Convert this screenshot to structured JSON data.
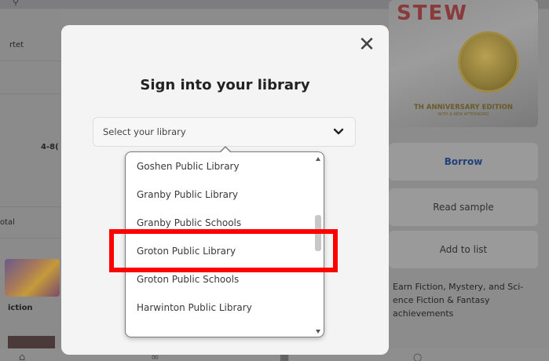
{
  "background": {
    "left_rows": [
      {
        "label": "rtet"
      },
      {
        "label": "4-8("
      },
      {
        "label": "otal"
      },
      {
        "label": "iction"
      }
    ],
    "cover": {
      "title": "STEW",
      "anniversary": "TH ANNIVERSARY EDITION",
      "anniversary_sub": "WITH A NEW AFTERWORD"
    },
    "buttons": {
      "borrow": "Borrow",
      "read_sample": "Read sample",
      "add_to_list": "Add to list"
    },
    "achievements": "Earn Fiction, Mystery, and Sci-ence Fiction & Fantasy achievements"
  },
  "modal": {
    "title": "Sign into your library",
    "close_icon": "close-icon",
    "select": {
      "placeholder": "Select your library",
      "chevron_icon": "chevron-down-icon"
    },
    "options": [
      "Goshen Public Library",
      "Granby Public Library",
      "Granby Public Schools",
      "Groton Public Library",
      "Groton Public Schools",
      "Harwinton Public Library"
    ],
    "highlighted_option": "Groton Public Library",
    "highlight_color": "#ff0000"
  }
}
